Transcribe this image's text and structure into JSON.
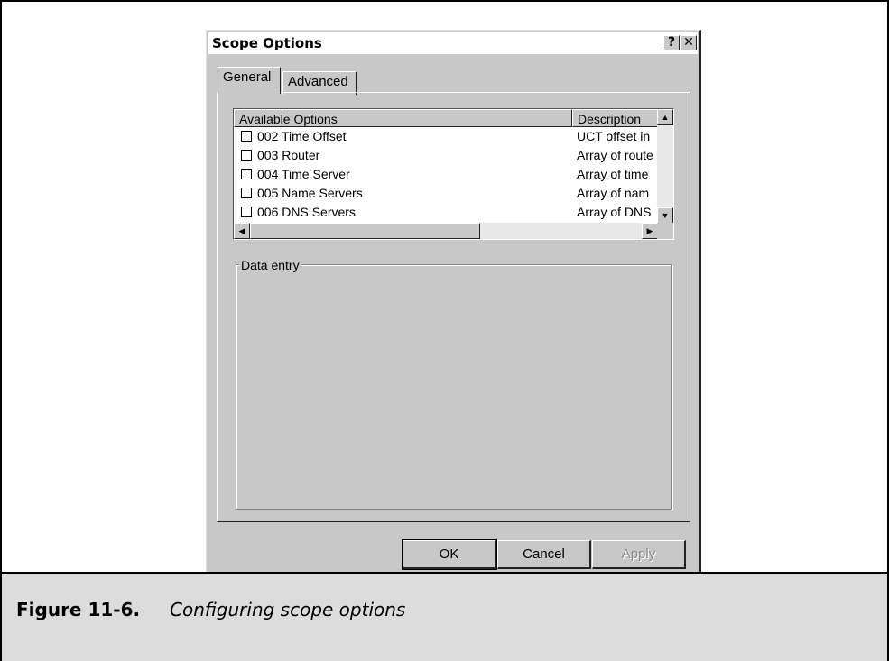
{
  "dialog": {
    "title": "Scope Options",
    "help_glyph": "?",
    "close_glyph": "✕",
    "tabs": [
      {
        "label": "General",
        "active": true
      },
      {
        "label": "Advanced",
        "active": false
      }
    ],
    "list": {
      "columns": [
        "Available Options",
        "Description"
      ],
      "rows": [
        {
          "name": "002 Time Offset",
          "description": "UCT offset in",
          "checked": false
        },
        {
          "name": "003 Router",
          "description": "Array of route",
          "checked": false
        },
        {
          "name": "004 Time Server",
          "description": "Array of time",
          "checked": false
        },
        {
          "name": "005 Name Servers",
          "description": "Array of nam",
          "checked": false
        },
        {
          "name": "006 DNS Servers",
          "description": "Array of DNS",
          "checked": false
        }
      ],
      "scroll_up_glyph": "▲",
      "scroll_down_glyph": "▼",
      "scroll_left_glyph": "◀",
      "scroll_right_glyph": "▶"
    },
    "group_label": "Data entry",
    "buttons": {
      "ok": "OK",
      "cancel": "Cancel",
      "apply": "Apply"
    }
  },
  "caption": {
    "number": "Figure 11-6.",
    "text": "Configuring scope options"
  },
  "colors": {
    "dialog_bg": "#c8c8c8",
    "caption_bg": "#dcdcdc"
  }
}
